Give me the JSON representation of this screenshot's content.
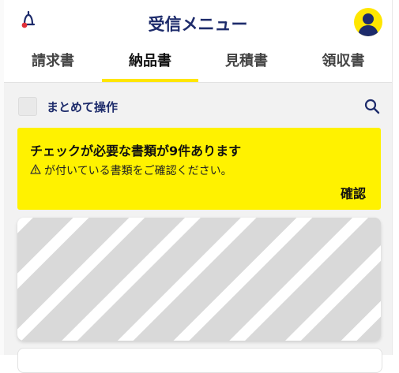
{
  "header": {
    "title": "受信メニュー",
    "logo_icon": "bell-icon",
    "avatar_icon": "user-avatar-icon"
  },
  "tabs": [
    {
      "label": "請求書"
    },
    {
      "label": "納品書",
      "active": true
    },
    {
      "label": "見積書"
    },
    {
      "label": "領収書"
    }
  ],
  "bulk": {
    "label": "まとめて操作",
    "search_icon": "search-icon"
  },
  "notice": {
    "title": "チェックが必要な書類が9件あります",
    "body": "が付いている書類をご確認ください。",
    "warning_icon": "warning-icon",
    "confirm_label": "確認"
  },
  "colors": {
    "accent_yellow": "#fff200",
    "navy": "#1d2b6b",
    "logo_red": "#e0303a"
  }
}
